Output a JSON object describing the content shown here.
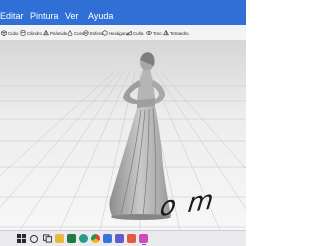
{
  "menubar": {
    "items": [
      "Editar",
      "Pintura",
      "Ver",
      "Ayuda"
    ]
  },
  "toolbar": {
    "shapes": [
      {
        "label": "Cubo",
        "icon": "cube-icon"
      },
      {
        "label": "Cilindro",
        "icon": "cylinder-icon"
      },
      {
        "label": "Pirámide",
        "icon": "pyramid-icon"
      },
      {
        "label": "Cono",
        "icon": "cone-icon"
      },
      {
        "label": "Esfera",
        "icon": "sphere-icon"
      },
      {
        "label": "Hexágono",
        "icon": "hexagon-icon"
      },
      {
        "label": "Cuña",
        "icon": "wedge-icon"
      },
      {
        "label": "Toro",
        "icon": "torus-icon"
      },
      {
        "label": "Tetraedro",
        "icon": "tetrahedron-icon"
      }
    ]
  },
  "viewport": {
    "floor_text": "o m"
  },
  "colors": {
    "menubar": "#2f6fd6",
    "toolbar": "#f3f3f3",
    "taskbar": "#e9e9ee"
  },
  "taskbar": {
    "apps": [
      "windows-icon",
      "search-icon",
      "task-view-icon",
      "file-explorer-icon",
      "excel-icon",
      "edge-icon",
      "chrome-icon",
      "store-icon",
      "app-icon",
      "app-icon-2",
      "paint3d-icon"
    ]
  }
}
